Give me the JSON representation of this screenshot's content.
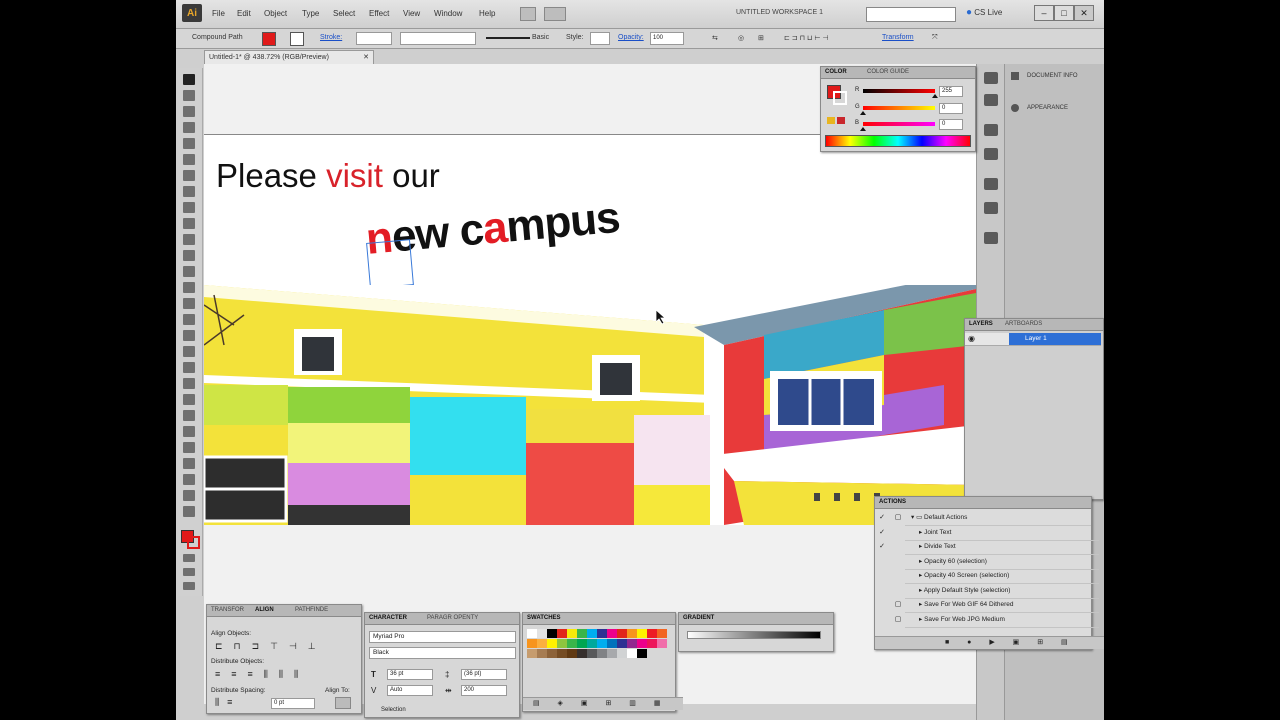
{
  "menu": {
    "logo": "Ai",
    "items": [
      "File",
      "Edit",
      "Object",
      "Type",
      "Select",
      "Effect",
      "View",
      "Window",
      "Help"
    ],
    "workspace": "UNTITLED WORKSPACE 1",
    "cs_live": "CS Live"
  },
  "control_bar": {
    "selection_type": "Compound Path",
    "stroke_label": "Stroke:",
    "stroke_style": "Basic",
    "style_label": "Style:",
    "opacity_label": "Opacity:",
    "opacity_value": "100",
    "transform_label": "Transform",
    "fill_color": "#e01a1a"
  },
  "document": {
    "tab_title": "Untitled-1* @ 438.72% (RGB/Preview)"
  },
  "artwork": {
    "line1_a": "Please ",
    "line1_b": "visit",
    "line1_c": " our",
    "line2_a": "n",
    "line2_b": "ew c",
    "line2_c": "a",
    "line2_d": "mpus",
    "accent_color": "#d8222a"
  },
  "color_panel": {
    "tab_color": "COLOR",
    "tab_guide": "COLOR GUIDE",
    "r_label": "R",
    "g_label": "G",
    "b_label": "B",
    "r_value": "255",
    "g_value": "0",
    "b_value": "0",
    "r_level": 1.0,
    "g_level": 0.0,
    "b_level": 0.0
  },
  "doc_panel": {
    "document_info": "DOCUMENT INFO",
    "appearance": "APPEARANCE"
  },
  "layers_panel": {
    "tab_layers": "LAYERS",
    "tab_artboards": "ARTBOARDS",
    "layer_name": "Layer 1"
  },
  "actions_panel": {
    "tab": "ACTIONS",
    "rows": [
      {
        "label": "Default Actions",
        "checked": true
      },
      {
        "label": "Joint Text",
        "checked": true
      },
      {
        "label": "Divide Text",
        "checked": true
      },
      {
        "label": "Opacity 60 (selection)",
        "checked": false
      },
      {
        "label": "Opacity 40 Screen (selection)",
        "checked": false
      },
      {
        "label": "Apply Default Style (selection)",
        "checked": false
      },
      {
        "label": "Save For Web GIF 64 Dithered",
        "checked": false
      },
      {
        "label": "Save For Web JPG Medium",
        "checked": false
      }
    ]
  },
  "align_panel": {
    "tab_transform": "TRANSFOR",
    "tab_align": "ALIGN",
    "tab_pathfinder": "PATHFINDE",
    "align_objects": "Align Objects:",
    "distribute_objects": "Distribute Objects:",
    "distribute_spacing": "Distribute Spacing:",
    "align_to": "Align To:",
    "spacing_value": "0 pt"
  },
  "character_panel": {
    "tab_character": "CHARACTER",
    "tab_paragraph": "PARAGR OPENTY",
    "font_family": "Myriad Pro",
    "font_style": "Black",
    "font_size": "36 pt",
    "leading": "(36 pt)",
    "kerning": "Auto",
    "tracking": "200",
    "footer": "Selection"
  },
  "swatches_panel": {
    "tab": "SWATCHES",
    "colors": [
      "#ffffff",
      "#e2e2e2",
      "#000000",
      "#e1251b",
      "#f7ea0a",
      "#3ab54a",
      "#00adef",
      "#2e3192",
      "#ec008c",
      "#e1251b",
      "#f7941d",
      "#fff200",
      "#ed1c24",
      "#f26522",
      "#f7941d",
      "#fbaf3f",
      "#fff200",
      "#8dc63f",
      "#39b54a",
      "#00a651",
      "#00a99d",
      "#00aeef",
      "#0072bc",
      "#2e3192",
      "#92278f",
      "#ec008c",
      "#ed145b",
      "#f06eaa",
      "#c69c6e",
      "#a67c52",
      "#8c6239",
      "#754c24",
      "#603913",
      "#362f2d",
      "#58595b",
      "#808285",
      "#a7a9ac",
      "#d1d3d4",
      "#ffffff",
      "#000000"
    ]
  },
  "gradient_panel": {
    "tab": "GRADIENT"
  }
}
